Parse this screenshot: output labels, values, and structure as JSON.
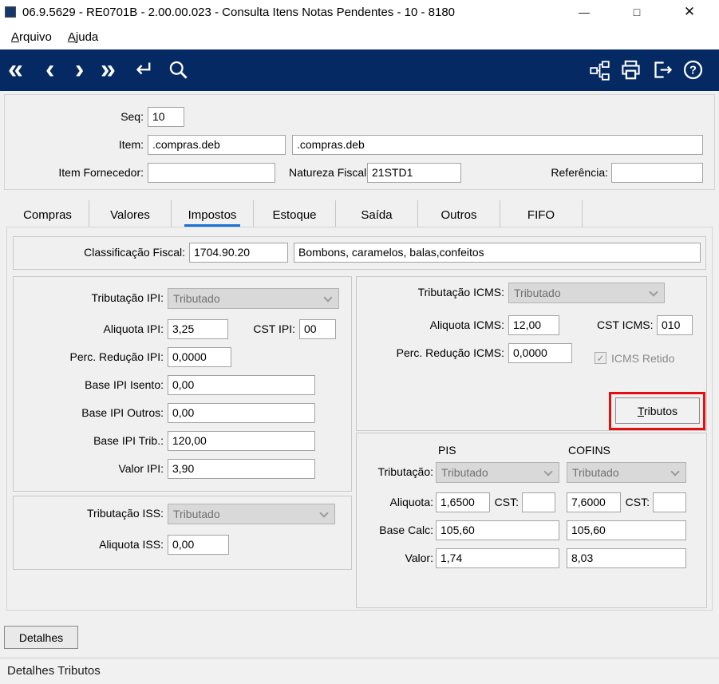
{
  "colors": {
    "toolbar_bg": "#052a63",
    "tab_active_underline": "#1a6fd4",
    "annotation_red": "#e60d0d"
  },
  "window": {
    "title": "06.9.5629 - RE0701B - 2.00.00.023 - Consulta Itens Notas Pendentes - 10 - 8180",
    "controls": {
      "minimize": "—",
      "maximize": "□",
      "close": "✕"
    }
  },
  "menu": {
    "items": [
      {
        "label": "Arquivo"
      },
      {
        "label": "Ajuda"
      }
    ]
  },
  "toolbar": {
    "nav": [
      {
        "name": "first-record-icon",
        "glyph": "«"
      },
      {
        "name": "prev-record-icon",
        "glyph": "‹"
      },
      {
        "name": "next-record-icon",
        "glyph": "›"
      },
      {
        "name": "last-record-icon",
        "glyph": "»"
      },
      {
        "name": "go-icon",
        "glyph": "↵"
      }
    ],
    "right_icons": [
      "hierarchy-icon",
      "print-icon",
      "exit-icon",
      "help-icon"
    ]
  },
  "header_form": {
    "seq": {
      "label": "Seq:",
      "value": "10"
    },
    "item": {
      "label": "Item:",
      "code": ".compras.deb",
      "desc": ".compras.deb"
    },
    "item_fornecedor": {
      "label": "Item Fornecedor:",
      "value": ""
    },
    "natureza_fiscal": {
      "label": "Natureza Fiscal",
      "value": "21STD1"
    },
    "referencia": {
      "label": "Referência:",
      "value": ""
    }
  },
  "tabs": {
    "items": [
      "Compras",
      "Valores",
      "Impostos",
      "Estoque",
      "Saída",
      "Outros",
      "FIFO"
    ],
    "active": "Impostos"
  },
  "impostos": {
    "classificacao": {
      "label": "Classificação Fiscal:",
      "code": "1704.90.20",
      "desc": "Bombons, caramelos, balas,confeitos"
    },
    "ipi": {
      "tributacao_label": "Tributação IPI:",
      "tributacao_value": "Tributado",
      "aliquota_label": "Aliquota IPI:",
      "aliquota_value": "3,25",
      "cst_label": "CST IPI:",
      "cst_value": "00",
      "perc_reducao_label": "Perc. Redução IPI:",
      "perc_reducao_value": "0,0000",
      "base_isento_label": "Base IPI Isento:",
      "base_isento_value": "0,00",
      "base_outros_label": "Base IPI Outros:",
      "base_outros_value": "0,00",
      "base_trib_label": "Base IPI Trib.:",
      "base_trib_value": "120,00",
      "valor_label": "Valor IPI:",
      "valor_value": "3,90"
    },
    "iss": {
      "tributacao_label": "Tributação ISS:",
      "tributacao_value": "Tributado",
      "aliquota_label": "Aliquota ISS:",
      "aliquota_value": "0,00"
    },
    "icms": {
      "tributacao_label": "Tributação ICMS:",
      "tributacao_value": "Tributado",
      "aliquota_label": "Aliquota ICMS:",
      "aliquota_value": "12,00",
      "cst_label": "CST ICMS:",
      "cst_value": "010",
      "perc_reducao_label": "Perc. Redução ICMS:",
      "perc_reducao_value": "0,0000",
      "retido_label": "ICMS Retido",
      "retido_checked": true,
      "check_glyph": "✓",
      "tributos_button": "Tributos"
    },
    "pis_cofins": {
      "pis_header": "PIS",
      "cofins_header": "COFINS",
      "tributacao_label": "Tributação:",
      "aliquota_label": "Aliquota:",
      "cst_label": "CST:",
      "base_label": "Base Calc:",
      "valor_label": "Valor:",
      "pis": {
        "tributacao": "Tributado",
        "aliquota": "1,6500",
        "cst": "",
        "base": "105,60",
        "valor": "1,74"
      },
      "cofins": {
        "tributacao": "Tributado",
        "aliquota": "7,6000",
        "cst": "",
        "base": "105,60",
        "valor": "8,03"
      }
    }
  },
  "footer": {
    "detalhes_button": "Detalhes",
    "status": "Detalhes Tributos"
  }
}
